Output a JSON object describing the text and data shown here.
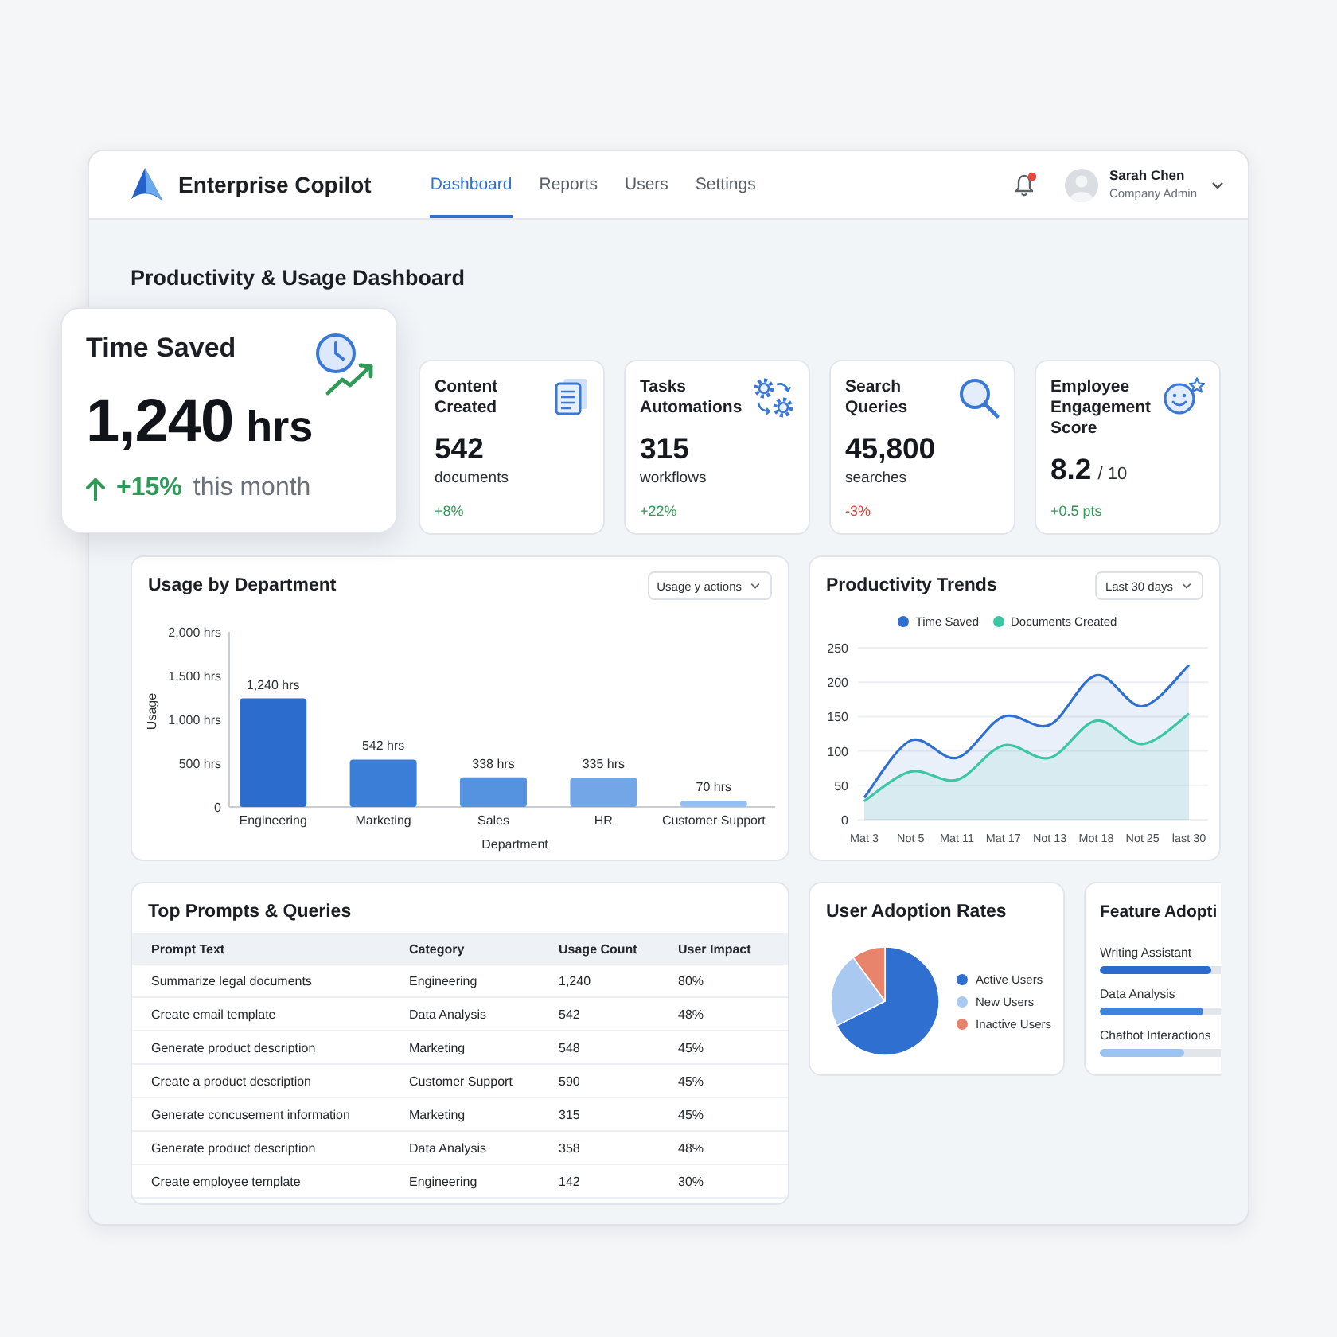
{
  "app": {
    "name": "Enterprise Copilot"
  },
  "nav_tabs": [
    {
      "label": "Dashboard",
      "selected": true
    },
    {
      "label": "Reports",
      "selected": false
    },
    {
      "label": "Users",
      "selected": false
    },
    {
      "label": "Settings",
      "selected": false
    }
  ],
  "notifications": {
    "unread": true
  },
  "user": {
    "name": "Sarah Chen",
    "role": "Company Admin"
  },
  "page_title": "Productivity & Usage Dashboard",
  "highlight_card": {
    "title": "Time Saved",
    "value": "1,240",
    "unit": "hrs",
    "negative": false,
    "change": "+15%",
    "period": "this month"
  },
  "kpi_cards": [
    {
      "title": "Content Created",
      "value": "542",
      "unit": "documents",
      "negative": false,
      "change": "+8%"
    },
    {
      "title": "Tasks Automations",
      "value": "315",
      "unit": "workflows",
      "negative": false,
      "change": "+22%"
    },
    {
      "title": "Search Queries",
      "value": "45,800",
      "unit": "searches",
      "negative": true,
      "change": "-3%"
    },
    {
      "title": "Employee Engagement Score",
      "value": "8.2",
      "scale": "/ 10",
      "negative": false,
      "change": "+0.5 pts"
    }
  ],
  "usage_chart": {
    "title": "Usage by Department",
    "filter": "Usage y actions",
    "chart_data": {
      "type": "bar",
      "xlabel": "Department",
      "ylabel": "Usage",
      "categories": [
        "Engineering",
        "Marketing",
        "Sales",
        "HR",
        "Customer Support"
      ],
      "values": [
        1240,
        542,
        338,
        335,
        70
      ],
      "ylim": [
        0,
        2000
      ],
      "yticks": [
        0,
        {
          "value": 500,
          "label": "500 hrs"
        },
        {
          "value": 1000,
          "label": "1,000 hrs"
        },
        {
          "value": 1500,
          "label": "1,500 hrs"
        },
        {
          "value": 2000,
          "label": "2,000 hrs"
        }
      ],
      "value_labels": [
        "1,240 hrs",
        "542 hrs",
        "338 hrs",
        "335 hrs",
        "70 hrs"
      ]
    }
  },
  "trends_chart": {
    "title": "Productivity Trends",
    "filter": "Last 30 days",
    "chart_data": {
      "type": "area",
      "x": [
        "Mat 3",
        "Not 5",
        "Mat 11",
        "Mat 17",
        "Not 13",
        "Mot 18",
        "Not 25",
        "last 30"
      ],
      "series": [
        {
          "name": "Time Saved",
          "color": "#2f6fd0",
          "values": [
            32,
            115,
            90,
            150,
            138,
            210,
            165,
            225
          ]
        },
        {
          "name": "Documents Created",
          "color": "#3cc6a4",
          "values": [
            27,
            70,
            58,
            108,
            90,
            144,
            110,
            154
          ]
        }
      ],
      "ylim": [
        0,
        250
      ],
      "yticks": [
        0,
        50,
        100,
        150,
        200,
        250
      ],
      "grid": true
    }
  },
  "top_prompts": {
    "title": "Top Prompts & Queries",
    "columns": [
      "Prompt Text",
      "Category",
      "Usage Count",
      "User Impact"
    ],
    "rows": [
      [
        "Summarize legal documents",
        "Engineering",
        "1,240",
        "80%"
      ],
      [
        "Create email template",
        "Data Analysis",
        "542",
        "48%"
      ],
      [
        "Generate product description",
        "Marketing",
        "548",
        "45%"
      ],
      [
        "Create a product description",
        "Customer Support",
        "590",
        "45%"
      ],
      [
        "Generate concusement information",
        "Marketing",
        "315",
        "45%"
      ],
      [
        "Generate product description",
        "Data Analysis",
        "358",
        "48%"
      ],
      [
        "Create employee template",
        "Engineering",
        "142",
        "30%"
      ]
    ]
  },
  "user_adoption": {
    "title": "User Adoption Rates",
    "legend": [
      {
        "label": "Active Users",
        "color": "#2f6fd0"
      },
      {
        "label": "New Users",
        "color": "#a9c9f1"
      },
      {
        "label": "Inactive Users",
        "color": "#e8846c"
      }
    ]
  },
  "feature_adoption": {
    "title": "Feature Adopti",
    "features": [
      {
        "label": "Writing Assistant",
        "level": 0.92
      },
      {
        "label": "Data Analysis",
        "level": 0.86
      },
      {
        "label": "Chatbot Interactions",
        "level": 0.7
      }
    ]
  }
}
